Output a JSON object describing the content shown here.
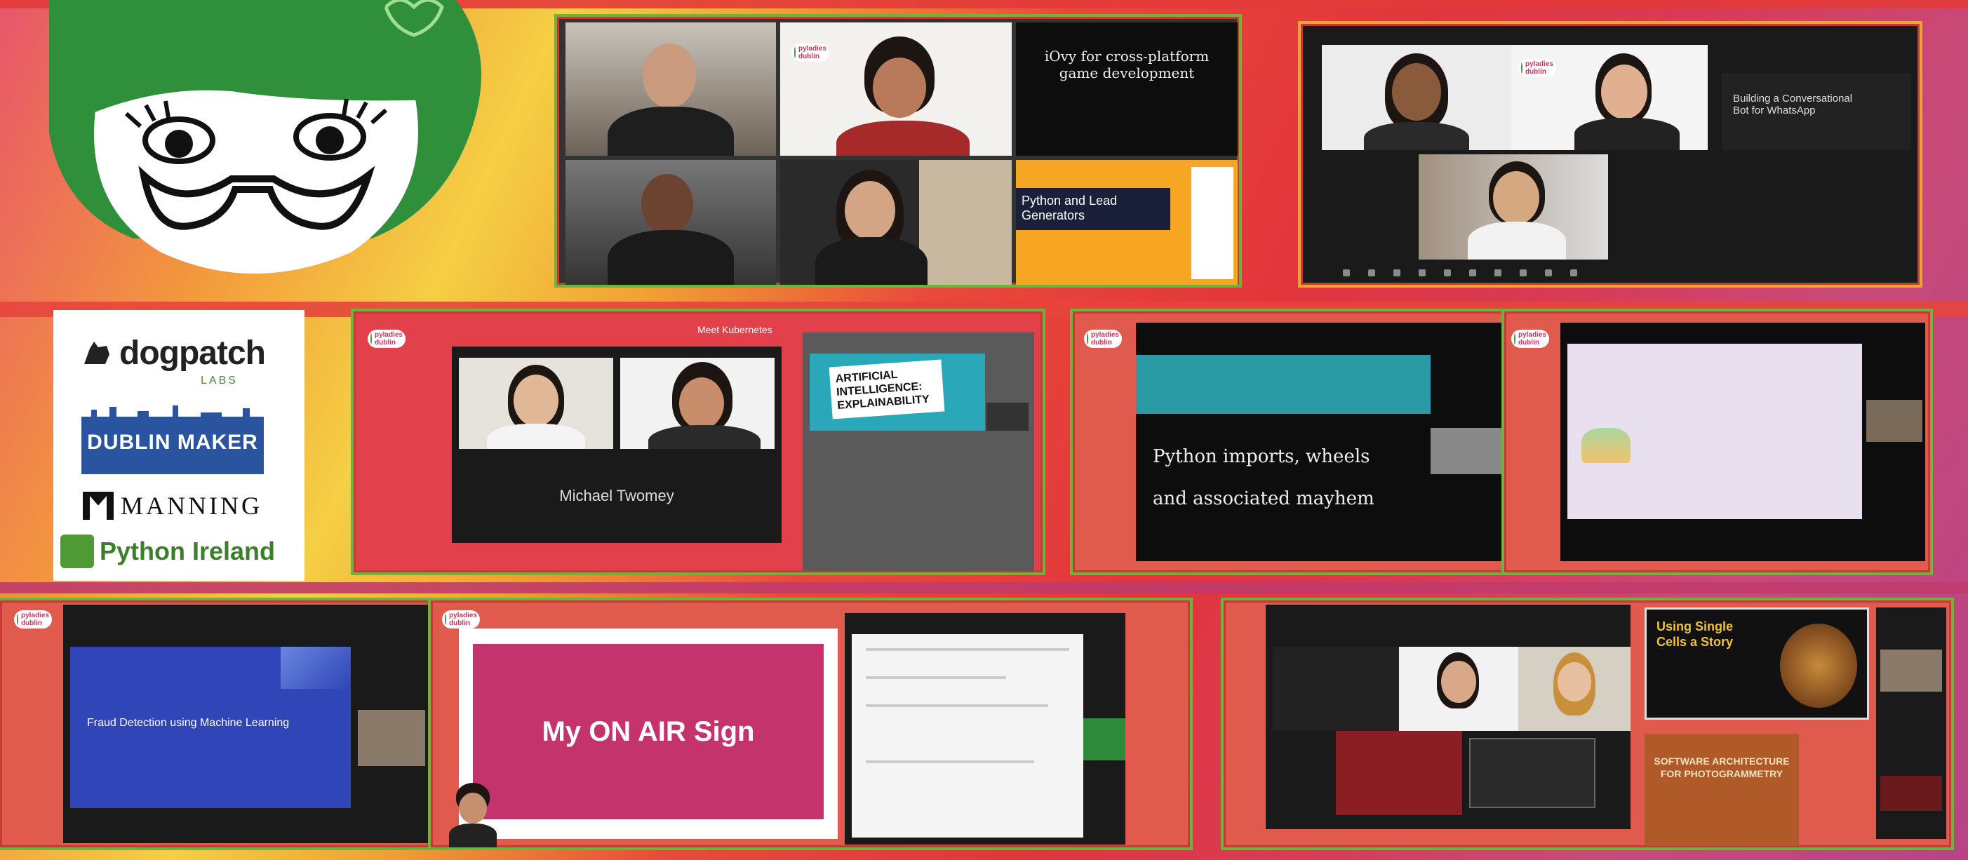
{
  "sponsors": {
    "dogpatch": "dogpatch",
    "dogpatch_sub": "LABS",
    "dublin_maker": "DUBLIN MAKER",
    "manning": "MANNING",
    "python_ireland": "Python Ireland"
  },
  "tiles": {
    "t1_slide": "iOvy for cross-platform game development",
    "t1_caption": "Python and Lead Generators",
    "t2_slide": "Building a Conversational Bot for WhatsApp",
    "t3_header": "Meet Kubernetes",
    "t3_speaker": "Michael Twomey",
    "t3_card": "ARTIFICIAL INTELLIGENCE: EXPLAINABILITY",
    "t4_line1": "Python imports, wheels",
    "t4_line2": "and associated mayhem",
    "t6_slide": "Fraud Detection using Machine Learning",
    "t7_slide": "My ON AIR Sign",
    "t8_card1": "Using Single Cells a Story",
    "t8_card2": "SOFTWARE ARCHITECTURE FOR PHOTOGRAMMETRY"
  },
  "badge": "pyladies dublin",
  "colors": {
    "frame_green": "#6fb23c",
    "frame_red": "#e24b3f",
    "pyladies_pink": "#d2335e"
  }
}
